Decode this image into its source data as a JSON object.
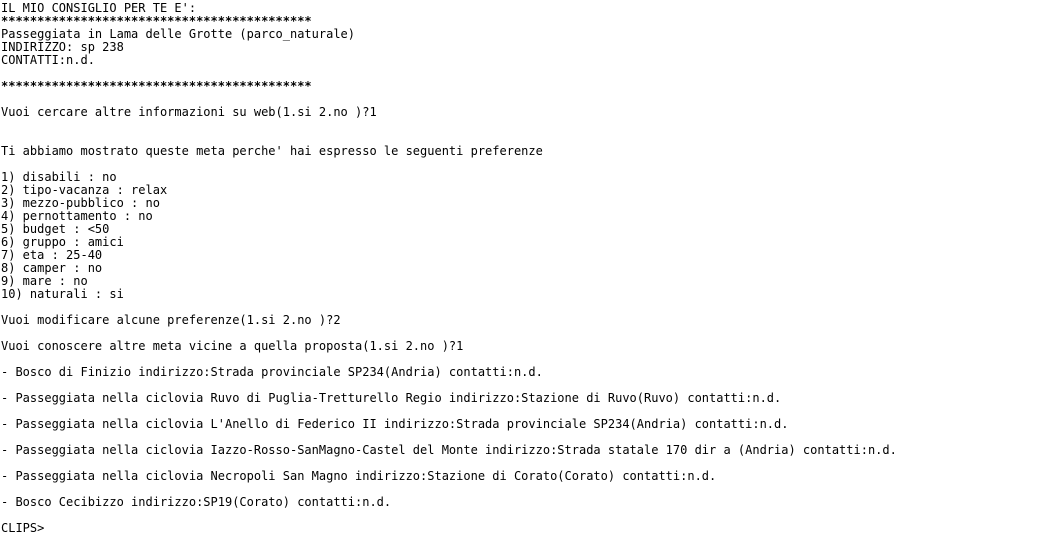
{
  "header": {
    "title": "IL MIO CONSIGLIO PER TE E':",
    "stars": "*******************************************"
  },
  "suggestion": {
    "name": "Passeggiata in Lama delle Grotte (parco_naturale)",
    "address": "INDIRIZZO: sp 238",
    "contacts": "CONTATTI:n.d."
  },
  "question_web": "Vuoi cercare altre informazioni su web(1.si 2.no )?1",
  "explanation": "Ti abbiamo mostrato queste meta perche' hai espresso le seguenti preferenze",
  "preferences": [
    "1) disabili : no",
    "2) tipo-vacanza : relax",
    "3) mezzo-pubblico : no",
    "4) pernottamento : no",
    "5) budget : <50",
    "6) gruppo : amici",
    "7) eta : 25-40",
    "8) camper : no",
    "9) mare : no",
    "10) naturali : si"
  ],
  "question_modify": "Vuoi modificare alcune preferenze(1.si 2.no )?2",
  "question_nearby": "Vuoi conoscere altre meta vicine a quella proposta(1.si 2.no )?1",
  "nearby": [
    "- Bosco di Finizio indirizzo:Strada provinciale SP234(Andria) contatti:n.d.",
    "- Passeggiata nella ciclovia Ruvo di Puglia-Tretturello Regio indirizzo:Stazione di Ruvo(Ruvo) contatti:n.d.",
    "- Passeggiata nella ciclovia L'Anello di Federico II indirizzo:Strada provinciale SP234(Andria) contatti:n.d.",
    "- Passeggiata nella ciclovia Iazzo-Rosso-SanMagno-Castel del Monte indirizzo:Strada statale 170 dir a (Andria) contatti:n.d.",
    "- Passeggiata nella ciclovia Necropoli San Magno indirizzo:Stazione di Corato(Corato) contatti:n.d.",
    "- Bosco Cecibizzo indirizzo:SP19(Corato) contatti:n.d."
  ],
  "prompt": "CLIPS>"
}
